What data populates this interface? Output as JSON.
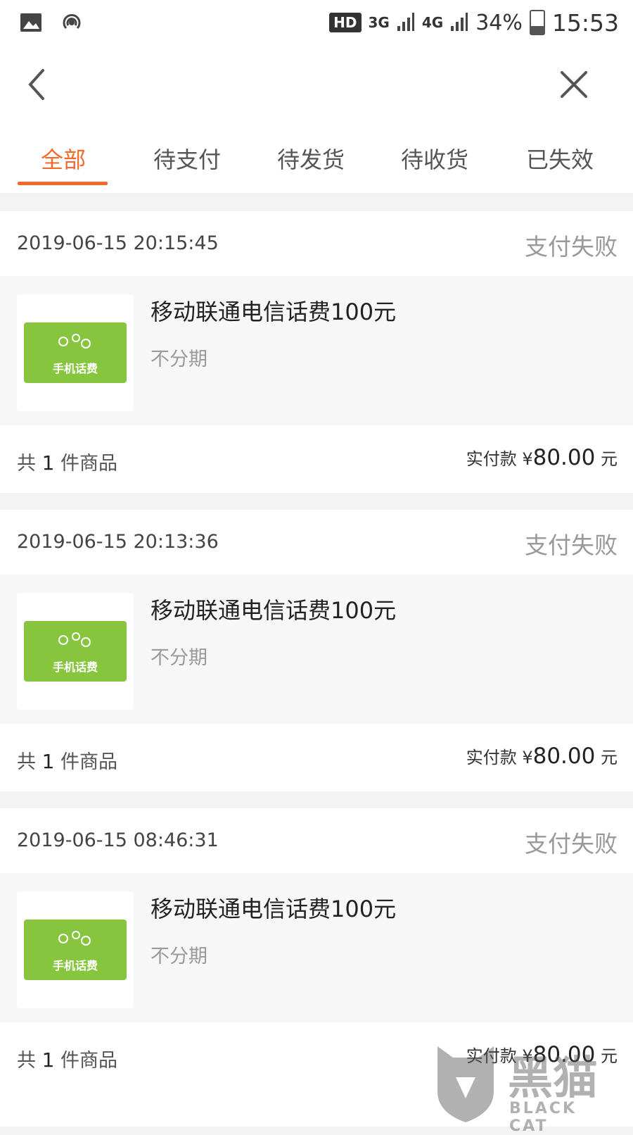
{
  "status_bar": {
    "hd": "HD",
    "net1": "3G",
    "net2": "4G",
    "battery": "34%",
    "battery_level": 0.34,
    "time": "15:53"
  },
  "header": {
    "back_icon": "chevron-left-icon",
    "close_icon": "close-icon"
  },
  "tabs": [
    {
      "label": "全部",
      "active": true
    },
    {
      "label": "待支付",
      "active": false
    },
    {
      "label": "待发货",
      "active": false
    },
    {
      "label": "待收货",
      "active": false
    },
    {
      "label": "已失效",
      "active": false
    }
  ],
  "accent_color": "#f26a2c",
  "orders": [
    {
      "time": "2019-06-15 20:15:45",
      "status": "支付失败",
      "item_name": "移动联通电信话费100元",
      "item_sub": "不分期",
      "card_label": "手机话费",
      "count_prefix": "共",
      "count": "1",
      "count_suffix": "件商品",
      "paid_label": "实付款 ¥",
      "paid_amount": "80.00",
      "paid_unit": "元"
    },
    {
      "time": "2019-06-15 20:13:36",
      "status": "支付失败",
      "item_name": "移动联通电信话费100元",
      "item_sub": "不分期",
      "card_label": "手机话费",
      "count_prefix": "共",
      "count": "1",
      "count_suffix": "件商品",
      "paid_label": "实付款 ¥",
      "paid_amount": "80.00",
      "paid_unit": "元"
    },
    {
      "time": "2019-06-15 08:46:31",
      "status": "支付失败",
      "item_name": "移动联通电信话费100元",
      "item_sub": "不分期",
      "card_label": "手机话费",
      "count_prefix": "共",
      "count": "1",
      "count_suffix": "件商品",
      "paid_label": "实付款 ¥",
      "paid_amount": "80.00",
      "paid_unit": "元"
    }
  ],
  "watermark": {
    "cn": "黑猫",
    "en": "BLACK CAT"
  }
}
